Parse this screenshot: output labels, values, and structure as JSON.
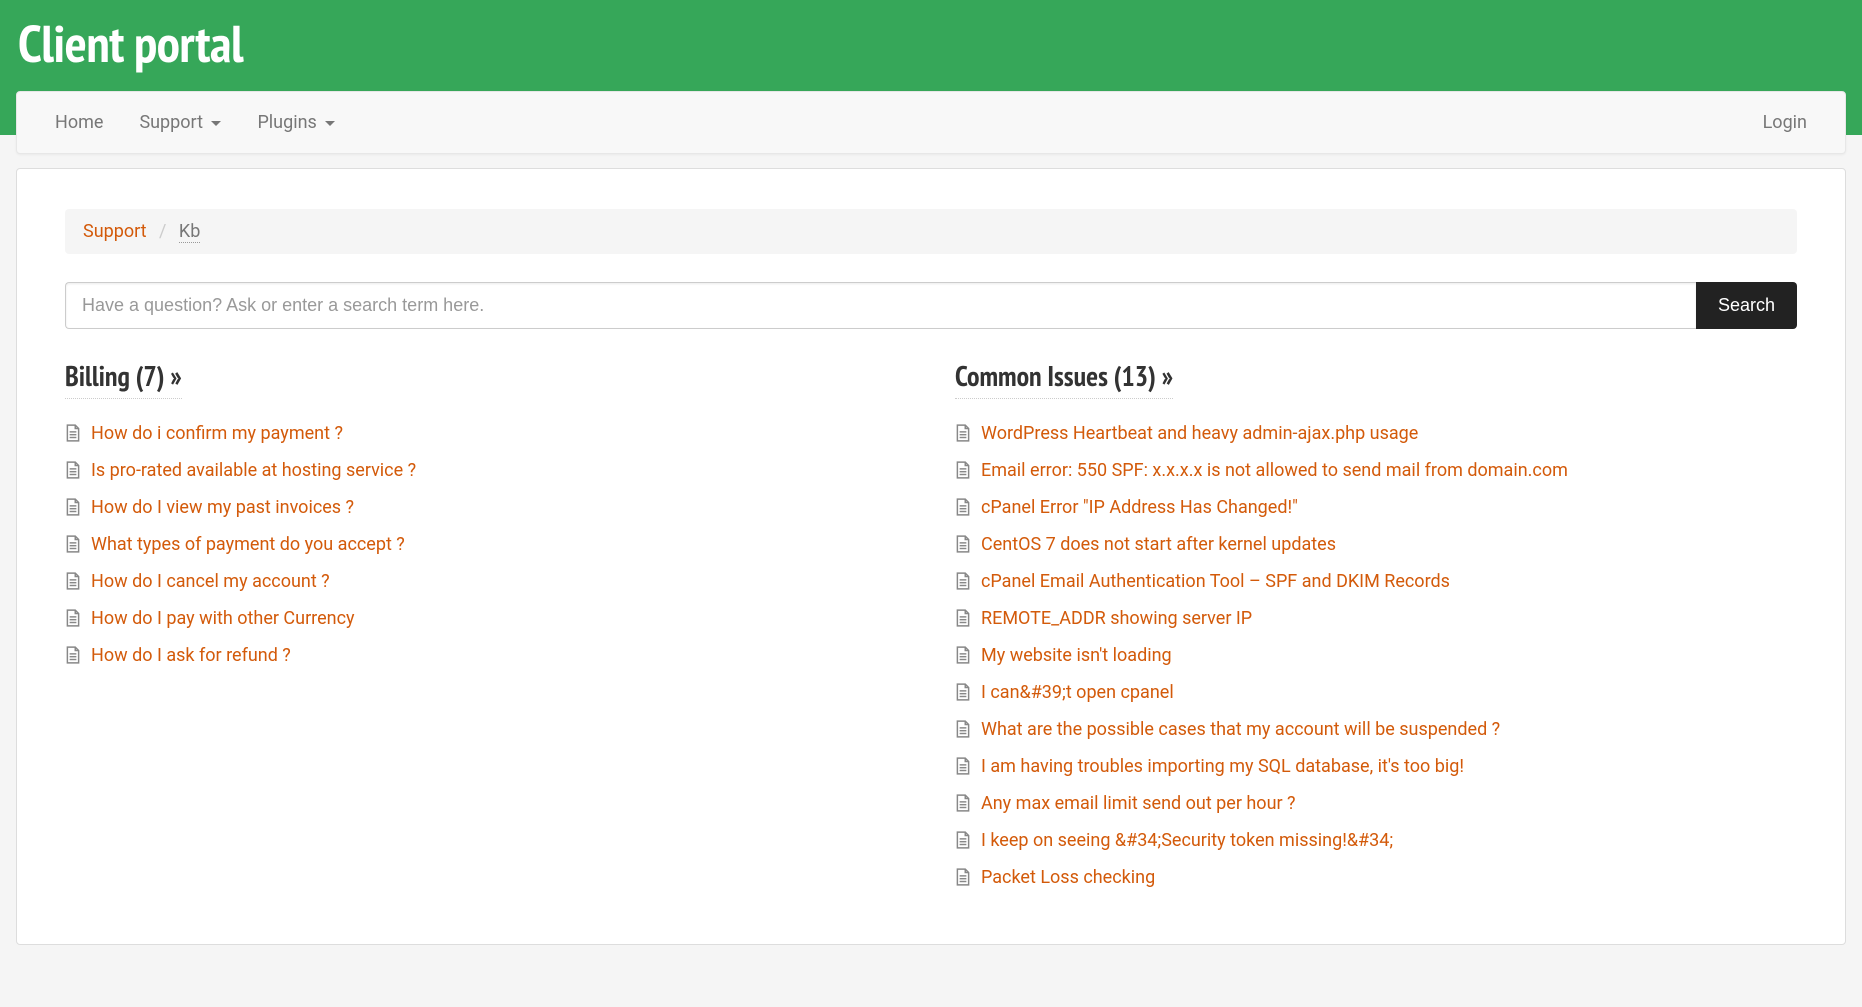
{
  "site_title": "Client portal",
  "nav": {
    "left": [
      {
        "label": "Home",
        "dropdown": false
      },
      {
        "label": "Support",
        "dropdown": true
      },
      {
        "label": "Plugins",
        "dropdown": true
      }
    ],
    "right": [
      {
        "label": "Login",
        "dropdown": false
      }
    ]
  },
  "breadcrumb": {
    "link": "Support",
    "active": "Kb"
  },
  "search": {
    "placeholder": "Have a question? Ask or enter a search term here.",
    "button": "Search"
  },
  "categories": [
    {
      "title": "Billing (7) »",
      "articles": [
        "How do i confirm my payment ?",
        "Is pro-rated available at hosting service ?",
        "How do I view my past invoices ?",
        "What types of payment do you accept ?",
        "How do I cancel my account ?",
        "How do I pay with other Currency",
        "How do I ask for refund ?"
      ]
    },
    {
      "title": "Common Issues (13) »",
      "articles": [
        "WordPress Heartbeat and heavy admin-ajax.php usage",
        "Email error: 550 SPF: x.x.x.x is not allowed to send mail from domain.com",
        "cPanel Error \"IP Address Has Changed!\"",
        "CentOS 7 does not start after kernel updates",
        "cPanel Email Authentication Tool – SPF and DKIM Records",
        "REMOTE_ADDR showing server IP",
        "My website isn't loading",
        "I can&#39;t open cpanel",
        "What are the possible cases that my account will be suspended ?",
        "I am having troubles importing my SQL database, it's too big!",
        "Any max email limit send out per hour ?",
        "I keep on seeing &#34;Security token missing!&#34;",
        "Packet Loss checking"
      ]
    }
  ]
}
